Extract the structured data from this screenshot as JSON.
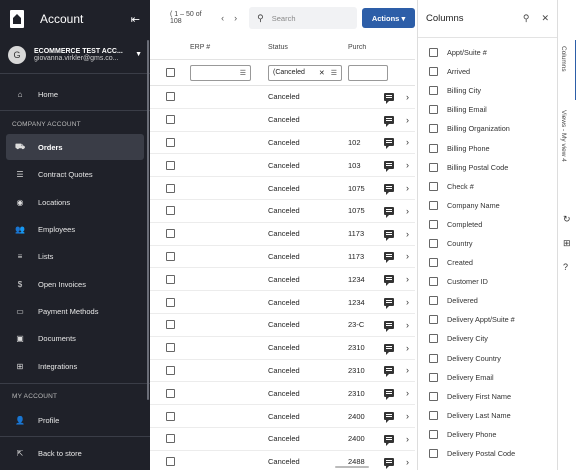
{
  "sidebar": {
    "title": "Account",
    "account": {
      "avatar_letter": "G",
      "name": "ECOMMERCE TEST ACC...",
      "email": "giovanna.virkler@gms.co..."
    },
    "home": "Home",
    "company_section": "COMPANY ACCOUNT",
    "items": [
      {
        "label": "Orders",
        "icon": "truck-icon",
        "active": true
      },
      {
        "label": "Contract Quotes",
        "icon": "document-list-icon"
      },
      {
        "label": "Locations",
        "icon": "location-pin-icon"
      },
      {
        "label": "Employees",
        "icon": "people-icon"
      },
      {
        "label": "Lists",
        "icon": "list-icon"
      },
      {
        "label": "Open Invoices",
        "icon": "dollar-icon"
      },
      {
        "label": "Payment Methods",
        "icon": "credit-card-icon"
      },
      {
        "label": "Documents",
        "icon": "folder-icon"
      },
      {
        "label": "Integrations",
        "icon": "integrations-icon"
      }
    ],
    "my_section": "MY ACCOUNT",
    "profile": "Profile",
    "back": "Back to store"
  },
  "toolbar": {
    "range": "1 – 50 of 108",
    "range_lead": "(",
    "search_placeholder": "Search",
    "actions_label": "Actions"
  },
  "grid": {
    "headers": {
      "erp": "ERP #",
      "status": "Status",
      "po": "Purch"
    },
    "status_filter": "(Canceled",
    "rows": [
      {
        "status": "Canceled",
        "po": ""
      },
      {
        "status": "Canceled",
        "po": ""
      },
      {
        "status": "Canceled",
        "po": "102"
      },
      {
        "status": "Canceled",
        "po": "103"
      },
      {
        "status": "Canceled",
        "po": "1075"
      },
      {
        "status": "Canceled",
        "po": "1075"
      },
      {
        "status": "Canceled",
        "po": "1173"
      },
      {
        "status": "Canceled",
        "po": "1173"
      },
      {
        "status": "Canceled",
        "po": "1234"
      },
      {
        "status": "Canceled",
        "po": "1234"
      },
      {
        "status": "Canceled",
        "po": "23-C"
      },
      {
        "status": "Canceled",
        "po": "2310"
      },
      {
        "status": "Canceled",
        "po": "2310"
      },
      {
        "status": "Canceled",
        "po": "2310"
      },
      {
        "status": "Canceled",
        "po": "2400"
      },
      {
        "status": "Canceled",
        "po": "2400"
      },
      {
        "status": "Canceled",
        "po": "2488"
      }
    ]
  },
  "columns_panel": {
    "title": "Columns",
    "items": [
      "Appt/Suite #",
      "Arrived",
      "Billing City",
      "Billing Email",
      "Billing Organization",
      "Billing Phone",
      "Billing Postal Code",
      "Check #",
      "Company Name",
      "Completed",
      "Country",
      "Created",
      "Customer ID",
      "Delivered",
      "Delivery Appt/Suite #",
      "Delivery City",
      "Delivery Country",
      "Delivery Email",
      "Delivery First Name",
      "Delivery Last Name",
      "Delivery Phone",
      "Delivery Postal Code"
    ]
  },
  "rail": {
    "columns_tab": "Columns",
    "views_tab": "Views - My view 4"
  }
}
